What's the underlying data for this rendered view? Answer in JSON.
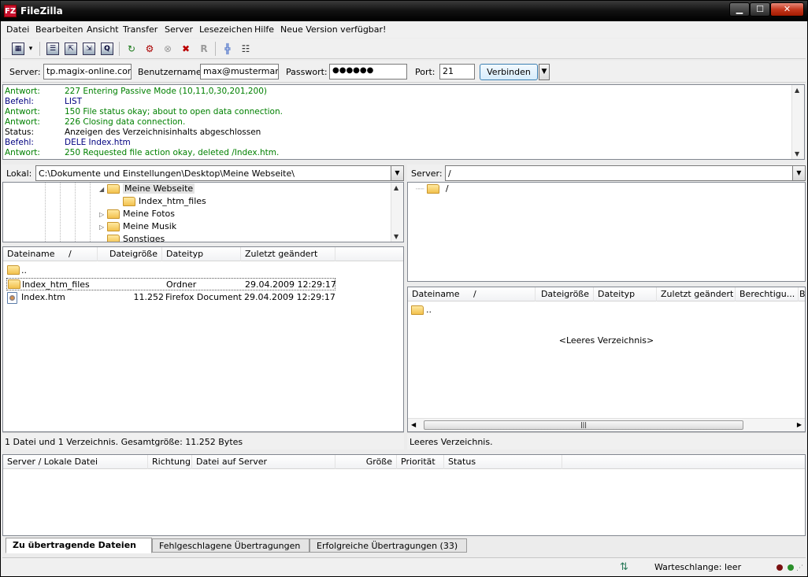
{
  "window": {
    "title": "FileZilla",
    "logo": "FZ",
    "min_glyph": "▁",
    "max_glyph": "☐",
    "close_glyph": "✕"
  },
  "menu": [
    "Datei",
    "Bearbeiten",
    "Ansicht",
    "Transfer",
    "Server",
    "Lesezeichen",
    "Hilfe",
    "Neue Version verfügbar!"
  ],
  "toolbar": {
    "icons": [
      "site-manager-icon",
      "toggle-log-icon",
      "toggle-local-tree-icon",
      "toggle-remote-tree-icon",
      "toggle-queue-icon",
      "refresh-icon",
      "process-queue-icon",
      "cancel-icon",
      "disconnect-icon",
      "reconnect-icon",
      "filter-icon",
      "compare-icon"
    ],
    "glyph_dropdown": "▾",
    "glyph_site_manager": "▦",
    "glyph_log": "☰",
    "glyph_local_tree": "⇱",
    "glyph_remote_tree": "⇲",
    "glyph_queue": "Q",
    "glyph_refresh": "↻",
    "glyph_process": "⚙",
    "glyph_cancel": "⊗",
    "glyph_disconnect": "✖",
    "glyph_reconnect": "R",
    "glyph_filter": "╬",
    "glyph_compare": "☷"
  },
  "quickconnect": {
    "server_label": "Server:",
    "server_value": "tp.magix-online.com",
    "user_label": "Benutzername:",
    "user_value": "max@mustermann.c",
    "pass_label": "Passwort:",
    "pass_value": "●●●●●●",
    "port_label": "Port:",
    "port_value": "21",
    "connect_label": "Verbinden",
    "dropdown_glyph": "▼"
  },
  "log": [
    {
      "kind": "resp",
      "label": "Antwort:",
      "msg": "227 Entering Passive Mode (10,11,0,30,201,200)"
    },
    {
      "kind": "cmd",
      "label": "Befehl:",
      "msg": "LIST"
    },
    {
      "kind": "resp",
      "label": "Antwort:",
      "msg": "150 File status okay; about to open data connection."
    },
    {
      "kind": "resp",
      "label": "Antwort:",
      "msg": "226 Closing data connection."
    },
    {
      "kind": "stat",
      "label": "Status:",
      "msg": "Anzeigen des Verzeichnisinhalts abgeschlossen"
    },
    {
      "kind": "cmd",
      "label": "Befehl:",
      "msg": "DELE Index.htm"
    },
    {
      "kind": "resp",
      "label": "Antwort:",
      "msg": "250 Requested file action okay, deleted /Index.htm."
    }
  ],
  "scroll": {
    "up": "▲",
    "down": "▼",
    "left": "◀",
    "right": "▶",
    "grip": "|||"
  },
  "local": {
    "label": "Lokal:",
    "path": "C:\\Dokumente und Einstellungen\\Desktop\\Meine Webseite\\",
    "tree": [
      {
        "name": "Meine Webseite",
        "indent": 0,
        "exp": "◢",
        "selected": true
      },
      {
        "name": "Index_htm_files",
        "indent": 1,
        "exp": ""
      },
      {
        "name": "Meine Fotos",
        "indent": 0,
        "exp": "▷"
      },
      {
        "name": "Meine Musik",
        "indent": 0,
        "exp": "▷"
      },
      {
        "name": "Sonstiges",
        "indent": 0,
        "exp": ""
      }
    ],
    "columns": [
      "Dateiname",
      "Dateigröße",
      "Dateityp",
      "Zuletzt geändert"
    ],
    "sort_glyph": "/",
    "files": [
      {
        "name": "..",
        "size": "",
        "type": "",
        "date": ""
      },
      {
        "name": "Index_htm_files",
        "size": "",
        "type": "Ordner",
        "date": "29.04.2009 12:29:17"
      },
      {
        "name": "Index.htm",
        "size": "11.252",
        "type": "Firefox Document",
        "date": "29.04.2009 12:29:17"
      }
    ],
    "status": "1 Datei und 1 Verzeichnis. Gesamtgröße: 11.252 Bytes"
  },
  "remote": {
    "label": "Server:",
    "path": "/",
    "tree": [
      {
        "name": "/"
      }
    ],
    "columns": [
      "Dateiname",
      "Dateigröße",
      "Dateityp",
      "Zuletzt geändert",
      "Berechtigu...",
      "B"
    ],
    "sort_glyph": "/",
    "files": [
      {
        "name": ".."
      }
    ],
    "empty_text": "<Leeres Verzeichnis>",
    "status": "Leeres Verzeichnis."
  },
  "queue": {
    "columns": [
      "Server / Lokale Datei",
      "Richtung",
      "Datei auf Server",
      "Größe",
      "Priorität",
      "Status"
    ]
  },
  "tabs": [
    "Zu übertragende Dateien",
    "Fehlgeschlagene Übertragungen",
    "Erfolgreiche Übertragungen (33)"
  ],
  "statusbar": {
    "queue_text": "Warteschlange: leer",
    "queue_icon": "⇅",
    "grip": "⋰"
  },
  "colors": {
    "log_response": "#008000",
    "log_command": "#00007f",
    "led_red": "#7a1010",
    "led_green": "#2a8f2a"
  }
}
